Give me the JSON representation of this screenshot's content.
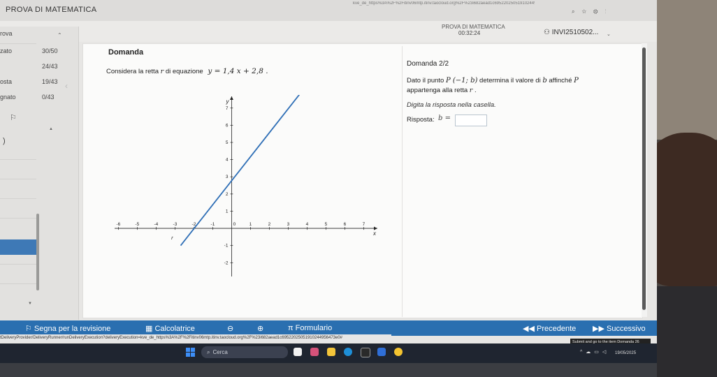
{
  "browser": {
    "app_title": "PROVA DI MATEMATICA",
    "url": "kve_de_https%3A%2F%2Fitinv06mtp.itinv.taocloud.org%2F%23i682aead1c69522025051910244956473e0",
    "icons": [
      "search-icon",
      "star-icon",
      "settings-icon",
      "more-icon"
    ]
  },
  "header": {
    "exam_name": "PROVA DI MATEMATICA",
    "timer": "00:32:24",
    "user_id": "INVI2510502...",
    "dropdown_icon": "chevron-down-icon"
  },
  "sidebar": {
    "section_label": "rova",
    "rows": [
      {
        "label": "zato",
        "value": "30/50"
      },
      {
        "label": "",
        "value": "24/43"
      },
      {
        "label": "osta",
        "value": "19/43"
      },
      {
        "label": "gnato",
        "value": "0/43"
      }
    ],
    "flag_icon": "flag-icon",
    "paren": ")"
  },
  "item": {
    "title": "Domanda",
    "stem_prefix": "Considera la retta",
    "stem_var": "r",
    "stem_mid": "di equazione",
    "equation": "y = 1,4 x + 2,8 ."
  },
  "question": {
    "number": "Domanda 2/2",
    "line1_prefix": "Dato il punto",
    "line1_point": "P (−1; b)",
    "line1_mid": "determina il valore di",
    "line1_var": "b",
    "line1_suffix": "affinché",
    "line1_var2": "P",
    "line2_prefix": "appartenga alla retta",
    "line2_var": "r",
    "line2_suffix": ".",
    "instruction": "Digita la risposta nella casella.",
    "answer_label": "Risposta:",
    "answer_var": "b ="
  },
  "chart_data": {
    "type": "line",
    "series": [
      {
        "name": "r",
        "slope": 1.4,
        "intercept": 2.8,
        "x": [
          -2.7,
          3.6
        ],
        "y": [
          -1.0,
          7.8
        ]
      }
    ],
    "xlabel": "x",
    "ylabel": "y",
    "xlim": [
      -6.2,
      7.5
    ],
    "ylim": [
      -2.8,
      7.6
    ],
    "xticks": [
      -6,
      -5,
      -4,
      -3,
      -2,
      -1,
      0,
      1,
      2,
      3,
      4,
      5,
      6,
      7
    ],
    "yticks": [
      -2,
      -1,
      0,
      1,
      2,
      3,
      4,
      5,
      6,
      7
    ],
    "xtick_labels": [
      "-6",
      "-5",
      "-4",
      "-3",
      "-2",
      "-1",
      "0",
      "1",
      "2",
      "3",
      "4",
      "5",
      "6",
      "7"
    ],
    "ytick_labels": [
      "-2",
      "-1",
      "0",
      "1",
      "2",
      "3",
      "4",
      "5",
      "6",
      "7"
    ],
    "line_label": "r",
    "grid": false,
    "color": "#2f6fb6"
  },
  "footer": {
    "review_label": "Segna per la revisione",
    "calculator_label": "Calcolatrice",
    "zoom_out_icon": "zoom-out-icon",
    "zoom_in_icon": "zoom-in-icon",
    "formulary_label": "Formulario",
    "prev_label": "Precedente",
    "next_label": "Successivo"
  },
  "status": {
    "url_text": "tDeliveryProvider/DeliveryRunner/runDeliveryExecution?deliveryExecution=kve_de_https%3A%2F%2Fitinv06mtp.itinv.taocloud.org%2F%23i682aead1c69522025051910244956473e0#",
    "tooltip": "Submit and go to the item Domanda 26"
  },
  "taskbar": {
    "search_placeholder": "Cerca",
    "date": "19/05/2025",
    "accent": "#2a6fb0"
  }
}
